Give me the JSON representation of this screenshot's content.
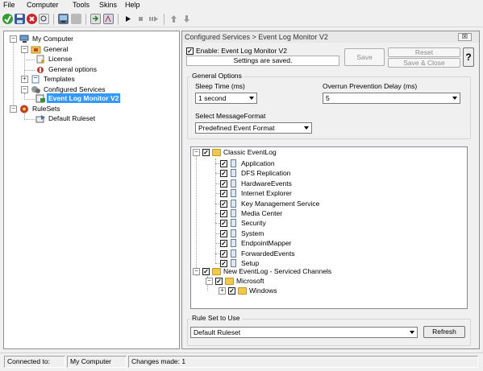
{
  "menu": {
    "items": [
      "File",
      "Computer",
      "Tools",
      "Skins",
      "Help"
    ]
  },
  "toolbar": {
    "icons": [
      "accept-icon",
      "save-icon",
      "cancel-icon",
      "find-icon",
      "computer-icon",
      "stop-square-icon",
      "export-icon",
      "debug-icon",
      "play-icon",
      "stop-icon",
      "step-icon",
      "up-arrow-icon",
      "down-arrow-icon"
    ]
  },
  "tree": {
    "root": "My Computer",
    "general": "General",
    "license": "License",
    "general_options": "General options",
    "templates": "Templates",
    "configured_services": "Configured Services",
    "event_log_monitor": "Event Log Monitor V2",
    "rulesets": "RuleSets",
    "default_ruleset": "Default Ruleset"
  },
  "panel": {
    "breadcrumb": "Configured Services > Event Log Monitor V2",
    "close_label": "☒",
    "enable_label": "Enable: Event Log Monitor V2",
    "enable_checked": true,
    "saved_message": "Settings are saved.",
    "save_label": "Save",
    "reset_label": "Reset",
    "save_close_label": "Save & Close",
    "help_label": "?"
  },
  "general_options": {
    "title": "General Options",
    "sleep_time_label": "Sleep Time (ms)",
    "sleep_time_value": "1 second",
    "overrun_label": "Overrun Prevention Delay (ms)",
    "overrun_value": "5",
    "format_label": "Select MessageFormat",
    "format_value": "Predefined Event Format"
  },
  "event_tree": {
    "classic": "Classic EventLog",
    "classic_children": [
      "Application",
      "DFS Replication",
      "HardwareEvents",
      "Internet Explorer",
      "Key Management Service",
      "Media Center",
      "Security",
      "System",
      "EndpointMapper",
      "ForwardedEvents",
      "Setup"
    ],
    "new_channels": "New EventLog - Serviced Channels",
    "microsoft": "Microsoft",
    "windows": "Windows"
  },
  "ruleset": {
    "label": "Rule Set to Use",
    "value": "Default Ruleset",
    "refresh_label": "Refresh"
  },
  "status": {
    "connected_label": "Connected to:",
    "connected_value": "My Computer",
    "changes_label": "Changes made: 1"
  },
  "colors": {
    "selection": "#3399ff",
    "folder": "#f3c94d",
    "background": "#f0f0f0"
  }
}
